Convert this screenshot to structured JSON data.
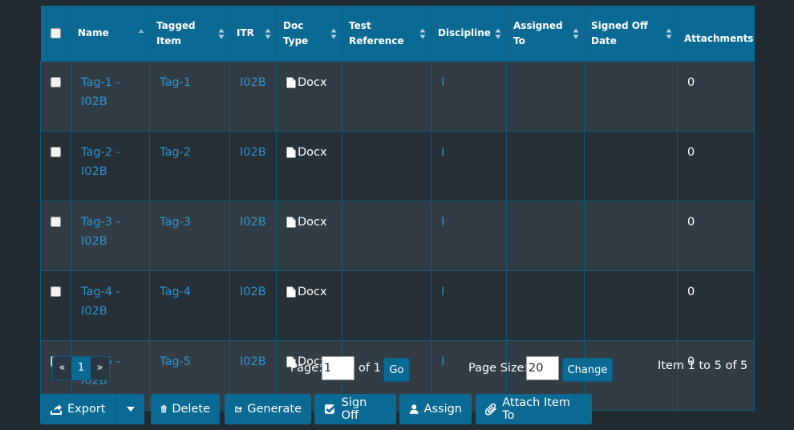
{
  "table": {
    "headers": {
      "name": "Name",
      "tagged_item": "Tagged Item",
      "itr": "ITR",
      "doc_type": "Doc Type",
      "test_reference": "Test Reference",
      "discipline": "Discipline",
      "assigned_to": "Assigned To",
      "signed_off_date": "Signed Off Date",
      "attachments": "Attachments"
    },
    "rows": [
      {
        "name": "Tag-1 - I02B",
        "tagged_item": "Tag-1",
        "itr": "I02B",
        "doc_type": "Docx",
        "test_reference": "",
        "discipline": "I",
        "assigned_to": "",
        "signed_off_date": "",
        "attachments": "0"
      },
      {
        "name": "Tag-2 - I02B",
        "tagged_item": "Tag-2",
        "itr": "I02B",
        "doc_type": "Docx",
        "test_reference": "",
        "discipline": "I",
        "assigned_to": "",
        "signed_off_date": "",
        "attachments": "0"
      },
      {
        "name": "Tag-3 - I02B",
        "tagged_item": "Tag-3",
        "itr": "I02B",
        "doc_type": "Docx",
        "test_reference": "",
        "discipline": "I",
        "assigned_to": "",
        "signed_off_date": "",
        "attachments": "0"
      },
      {
        "name": "Tag-4 - I02B",
        "tagged_item": "Tag-4",
        "itr": "I02B",
        "doc_type": "Docx",
        "test_reference": "",
        "discipline": "I",
        "assigned_to": "",
        "signed_off_date": "",
        "attachments": "0"
      },
      {
        "name": "Tag-5 - I02B",
        "tagged_item": "Tag-5",
        "itr": "I02B",
        "doc_type": "Docx",
        "test_reference": "",
        "discipline": "I",
        "assigned_to": "",
        "signed_off_date": "",
        "attachments": "0"
      }
    ]
  },
  "pagination": {
    "prev": "«",
    "current": "1",
    "next": "»",
    "page_label": "Page:",
    "page_value": "1",
    "of_label": "of 1",
    "go": "Go",
    "page_size_label": "Page Size:",
    "page_size_value": "20",
    "change": "Change",
    "summary": "Item 1 to 5 of 5"
  },
  "toolbar": {
    "export": "Export",
    "delete": "Delete",
    "generate": "Generate",
    "sign_off": "Sign Off",
    "assign": "Assign",
    "attach_item_to": "Attach Item To"
  },
  "icons": {
    "export": "export-icon",
    "delete": "trash-icon",
    "generate": "share-square-icon",
    "sign_off": "check-square-icon",
    "assign": "user-icon",
    "attach": "paperclip-icon",
    "doc": "file-icon",
    "sort": "sort-icon",
    "dropdown": "caret-down-icon"
  },
  "colors": {
    "background": "#222b31",
    "header": "#0a6a93",
    "row_odd": "#323c44",
    "row_even": "#263036",
    "link": "#2d93cf",
    "button": "#0a6a93"
  }
}
